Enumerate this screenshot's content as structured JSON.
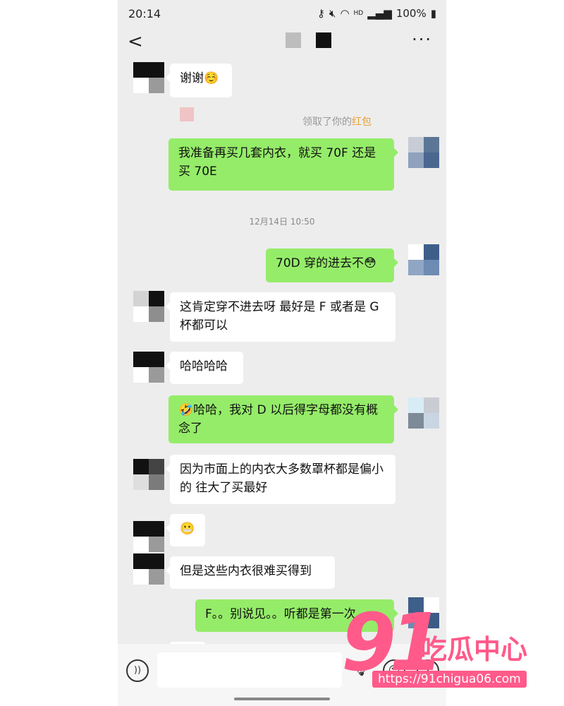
{
  "status_bar": {
    "time": "20:14",
    "icons": [
      "key-icon",
      "mute-icon",
      "wifi-icon",
      "hd-icon",
      "signal-icon"
    ],
    "hd": "HD",
    "battery": "100%"
  },
  "nav": {
    "back": "<",
    "more": "···"
  },
  "redpacket": {
    "prefix": "领取了你的",
    "highlight": "红包"
  },
  "timestamp": "12月14日 10:50",
  "messages": [
    {
      "side": "left",
      "text": "谢谢☺️"
    },
    {
      "side": "right",
      "text": "我准备再买几套内衣，就买 70F 还是买 70E"
    },
    {
      "side": "right",
      "text": "70D 穿的进去不😳"
    },
    {
      "side": "left",
      "text": "这肯定穿不进去呀 最好是 F 或者是 G杯都可以"
    },
    {
      "side": "left",
      "text": "哈哈哈哈"
    },
    {
      "side": "right",
      "text": "🤣哈哈，我对 D 以后得字母都没有概念了"
    },
    {
      "side": "left",
      "text": "因为市面上的内衣大多数罩杯都是偏小的 往大了买最好"
    },
    {
      "side": "left",
      "text": "😬"
    },
    {
      "side": "left",
      "text": "但是这些内衣很难买得到"
    },
    {
      "side": "right",
      "text": "F。。别说见。。听都是第一次"
    }
  ],
  "input": {
    "voice": "))",
    "emoji": "☺",
    "plus": "+"
  },
  "watermark": {
    "number": "91",
    "title": "吃瓜中心",
    "url": "https://91chigua06.com"
  }
}
